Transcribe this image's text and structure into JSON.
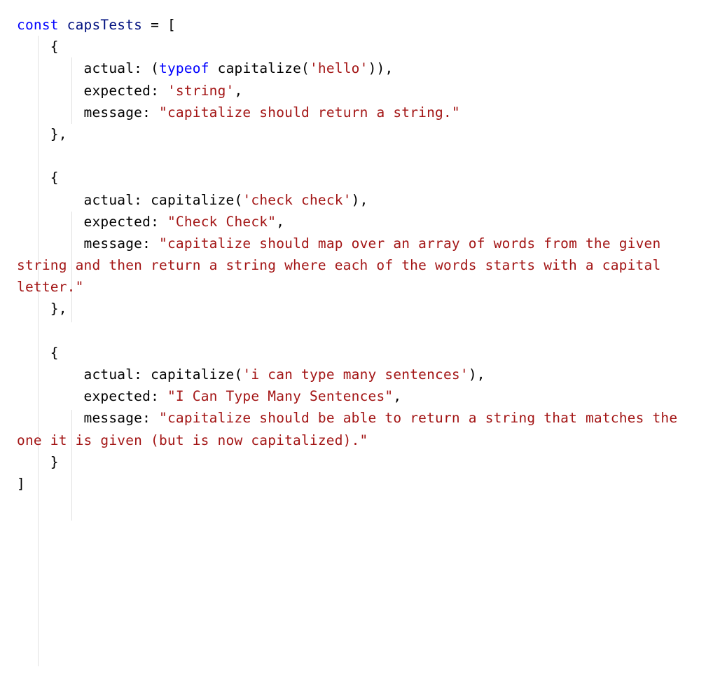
{
  "tokens": {
    "t0": "const",
    "t1": " ",
    "t2": "capsTests",
    "t3": " ",
    "t4": "=",
    "t5": " ",
    "t6": "[",
    "t7": "\n    ",
    "t8": "{",
    "t9": "\n        ",
    "t10": "actual",
    "t11": ":",
    "t12": " ",
    "t13": "(",
    "t14": "typeof",
    "t15": " ",
    "t16": "capitalize",
    "t17": "(",
    "t18": "'hello'",
    "t19": ")",
    "t20": ")",
    "t21": ",",
    "t22": "\n        ",
    "t23": "expected",
    "t24": ":",
    "t25": " ",
    "t26": "'string'",
    "t27": ",",
    "t28": "\n        ",
    "t29": "message",
    "t30": ":",
    "t31": " ",
    "t32": "\"capitalize should return a string.\"",
    "t33": "\n    ",
    "t34": "}",
    "t35": ",",
    "t36": "\n",
    "t37": "\n    ",
    "t38": "{",
    "t39": "\n        ",
    "t40": "actual",
    "t41": ":",
    "t42": " ",
    "t43": "capitalize",
    "t44": "(",
    "t45": "'check check'",
    "t46": ")",
    "t47": ",",
    "t48": "\n        ",
    "t49": "expected",
    "t50": ":",
    "t51": " ",
    "t52": "\"Check Check\"",
    "t53": ",",
    "t54": "\n        ",
    "t55": "message",
    "t56": ":",
    "t57": " ",
    "t58": "\"capitalize should map over an array of words from the given string and then return a string where each of the words starts with a capital letter.\"",
    "t59": "\n    ",
    "t60": "}",
    "t61": ",",
    "t62": "\n",
    "t63": "\n    ",
    "t64": "{",
    "t65": "\n        ",
    "t66": "actual",
    "t67": ":",
    "t68": " ",
    "t69": "capitalize",
    "t70": "(",
    "t71": "'i can type many sentences'",
    "t72": ")",
    "t73": ",",
    "t74": "\n        ",
    "t75": "expected",
    "t76": ":",
    "t77": " ",
    "t78": "\"I Can Type Many Sentences\"",
    "t79": ",",
    "t80": "\n        ",
    "t81": "message",
    "t82": ":",
    "t83": " ",
    "t84": "\"capitalize should be able to return a string that matches the one it is given (but is now capitalized).\"",
    "t85": "\n    ",
    "t86": "}",
    "t87": "\n",
    "t88": "]"
  },
  "chart_data": {
    "type": "table",
    "title": "capsTests array — JavaScript test definitions",
    "columns": [
      "actual",
      "expected",
      "message"
    ],
    "rows": [
      {
        "actual": "(typeof capitalize('hello'))",
        "expected": "'string'",
        "message": "capitalize should return a string."
      },
      {
        "actual": "capitalize('check check')",
        "expected": "\"Check Check\"",
        "message": "capitalize should map over an array of words from the given string and then return a string where each of the words starts with a capital letter."
      },
      {
        "actual": "capitalize('i can type many sentences')",
        "expected": "\"I Can Type Many Sentences\"",
        "message": "capitalize should be able to return a string that matches the one it is given (but is now capitalized)."
      }
    ]
  }
}
